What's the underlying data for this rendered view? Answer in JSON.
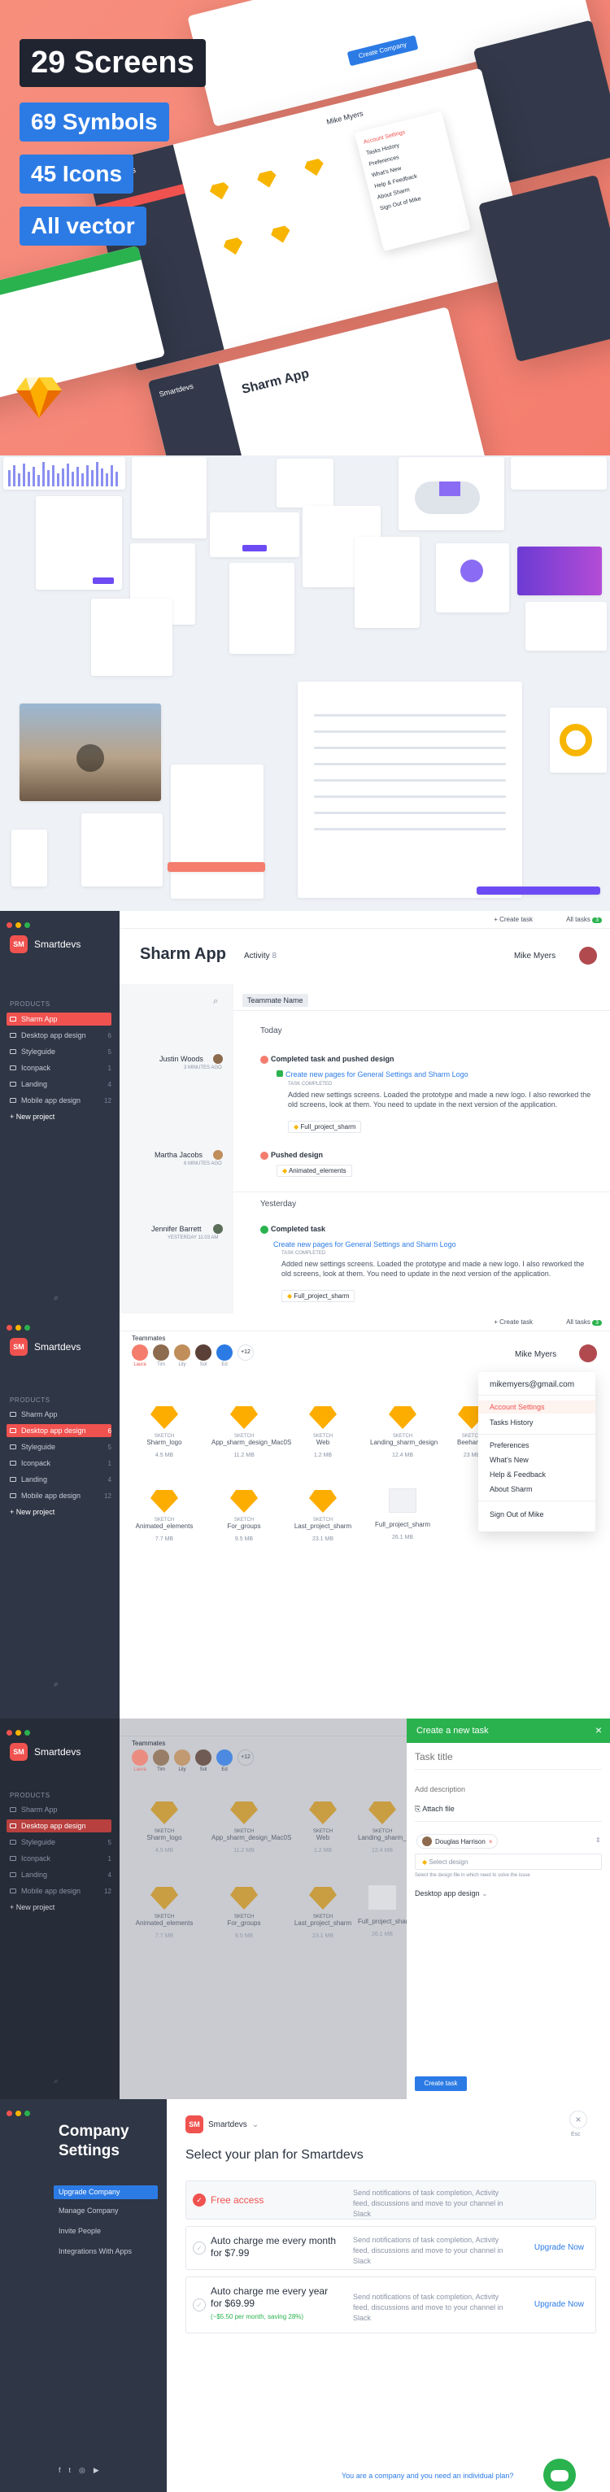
{
  "hero": {
    "tags": [
      "29 Screens",
      "69 Symbols",
      "45 Icons",
      "All vector"
    ],
    "card_app_name": "Sharm App",
    "card_org": "Smartdevs",
    "card_user": "Mike Myers",
    "card_button": "Create Company",
    "menu_items": [
      "Account Settings",
      "Tasks History",
      "Preferences",
      "What's New",
      "Help & Feedback",
      "About Sharm",
      "Sign Out of Mike"
    ]
  },
  "app": {
    "org_initials": "SM",
    "org_name": "Smartdevs",
    "section": "PRODUCTS",
    "projects": [
      {
        "label": "Sharm App",
        "count": "6"
      },
      {
        "label": "Desktop app design",
        "count": "6"
      },
      {
        "label": "Styleguide",
        "count": "5"
      },
      {
        "label": "Iconpack",
        "count": "1"
      },
      {
        "label": "Landing",
        "count": "4"
      },
      {
        "label": "Mobile app design",
        "count": "12"
      }
    ],
    "new_project": "+  New project",
    "create_task": "+  Create task",
    "all_tasks": "All tasks",
    "all_tasks_count": "3",
    "user": "Mike Myers"
  },
  "activity": {
    "app_title": "Sharm App",
    "tab": "Activity",
    "tab_count": "8",
    "search_tag": "Teammate Name",
    "today": "Today",
    "yesterday": "Yesterday",
    "entries": [
      {
        "name": "Justin Woods",
        "time": "3 MINUTES AGO",
        "action": "Completed task and pushed design",
        "task": "Create new pages for General Settings and Sharm Logo",
        "status": "TASK COMPLETED",
        "body": "Added new settings screens. Loaded the prototype and made a new logo. I also reworked the old screens, look at them. You need to update in the next version of the application.",
        "file": "Full_project_sharm"
      },
      {
        "name": "Martha Jacobs",
        "time": "6 MINUTES AGO",
        "action": "Pushed design",
        "file": "Animated_elements"
      },
      {
        "name": "Jennifer Barrett",
        "time": "YESTERDAY 11:03 AM",
        "action": "Completed task",
        "task": "Create new pages for General Settings and Sharm Logo",
        "status": "TASK COMPLETED",
        "body": "Added new settings screens. Loaded the prototype and made a new logo. I also reworked the old screens, look at them. You need to update in the next version of the application.",
        "file": "Full_project_sharm"
      }
    ]
  },
  "files": {
    "teammates_title": "Teammates",
    "teammates": [
      "Laura",
      "Tim",
      "Lily",
      "Sol",
      "Ed"
    ],
    "more": "+12",
    "email": "mikemyers@gmail.com",
    "menu": [
      "Account Settings",
      "Tasks History",
      "Preferences",
      "What's New",
      "Help & Feedback",
      "About Sharm",
      "Sign Out of Mike"
    ],
    "sketch_label": "SKETCH",
    "tiles": [
      {
        "name": "Sharm_logo",
        "size": "4.5 MB"
      },
      {
        "name": "App_sharm_design_Mac0S",
        "size": "11.2 MB"
      },
      {
        "name": "Web",
        "size": "1.2 MB"
      },
      {
        "name": "Landing_sharm_design",
        "size": "12.4 MB"
      },
      {
        "name": "Beehance",
        "size": "23 MB"
      },
      {
        "name": "Animated_elements",
        "size": "7.7 MB"
      },
      {
        "name": "For_groups",
        "size": "9.5 MB"
      },
      {
        "name": "Last_project_sharm",
        "size": "23.1 MB"
      },
      {
        "name": "Full_project_sharm",
        "size": "26.1 MB"
      }
    ]
  },
  "new_task": {
    "header": "Create a new task",
    "title_placeholder": "Task title",
    "desc_placeholder": "Add description",
    "attach": "Attach file",
    "assignee": "Douglas Harrison",
    "design_placeholder": "Select design",
    "hint": "Select the design file in which need to solve the issue",
    "project": "Desktop app design",
    "submit": "Create task"
  },
  "settings": {
    "title": "Company Settings",
    "nav": [
      "Upgrade Company",
      "Manage Company",
      "Invite People",
      "Integrations With Apps"
    ],
    "org_name": "Smartdevs",
    "heading": "Select your plan for Smartdevs",
    "close": "Esc",
    "plans": [
      {
        "title": "Free access",
        "desc": "Send notifications of task completion, Activity feed, discussions and move to your channel in Slack",
        "action": ""
      },
      {
        "title": "Auto charge me every month for $7.99",
        "desc": "Send notifications of task completion, Activity feed, discussions and move to your channel in Slack",
        "action": "Upgrade Now"
      },
      {
        "title": "Auto charge me every year for $69.99",
        "sub": "(~$5.50 per month, saving 28%)",
        "desc": "Send notifications of task completion, Activity feed, discussions and move to your channel in Slack",
        "action": "Upgrade Now"
      }
    ],
    "footer": "You are a company and you need an individual plan?"
  },
  "colors": {
    "accent": "#f0524f",
    "sidebar": "#2f3645",
    "link": "#2c7be5",
    "success": "#2ab24e",
    "purple": "#6c4bf4",
    "hero": "#f6897a"
  }
}
